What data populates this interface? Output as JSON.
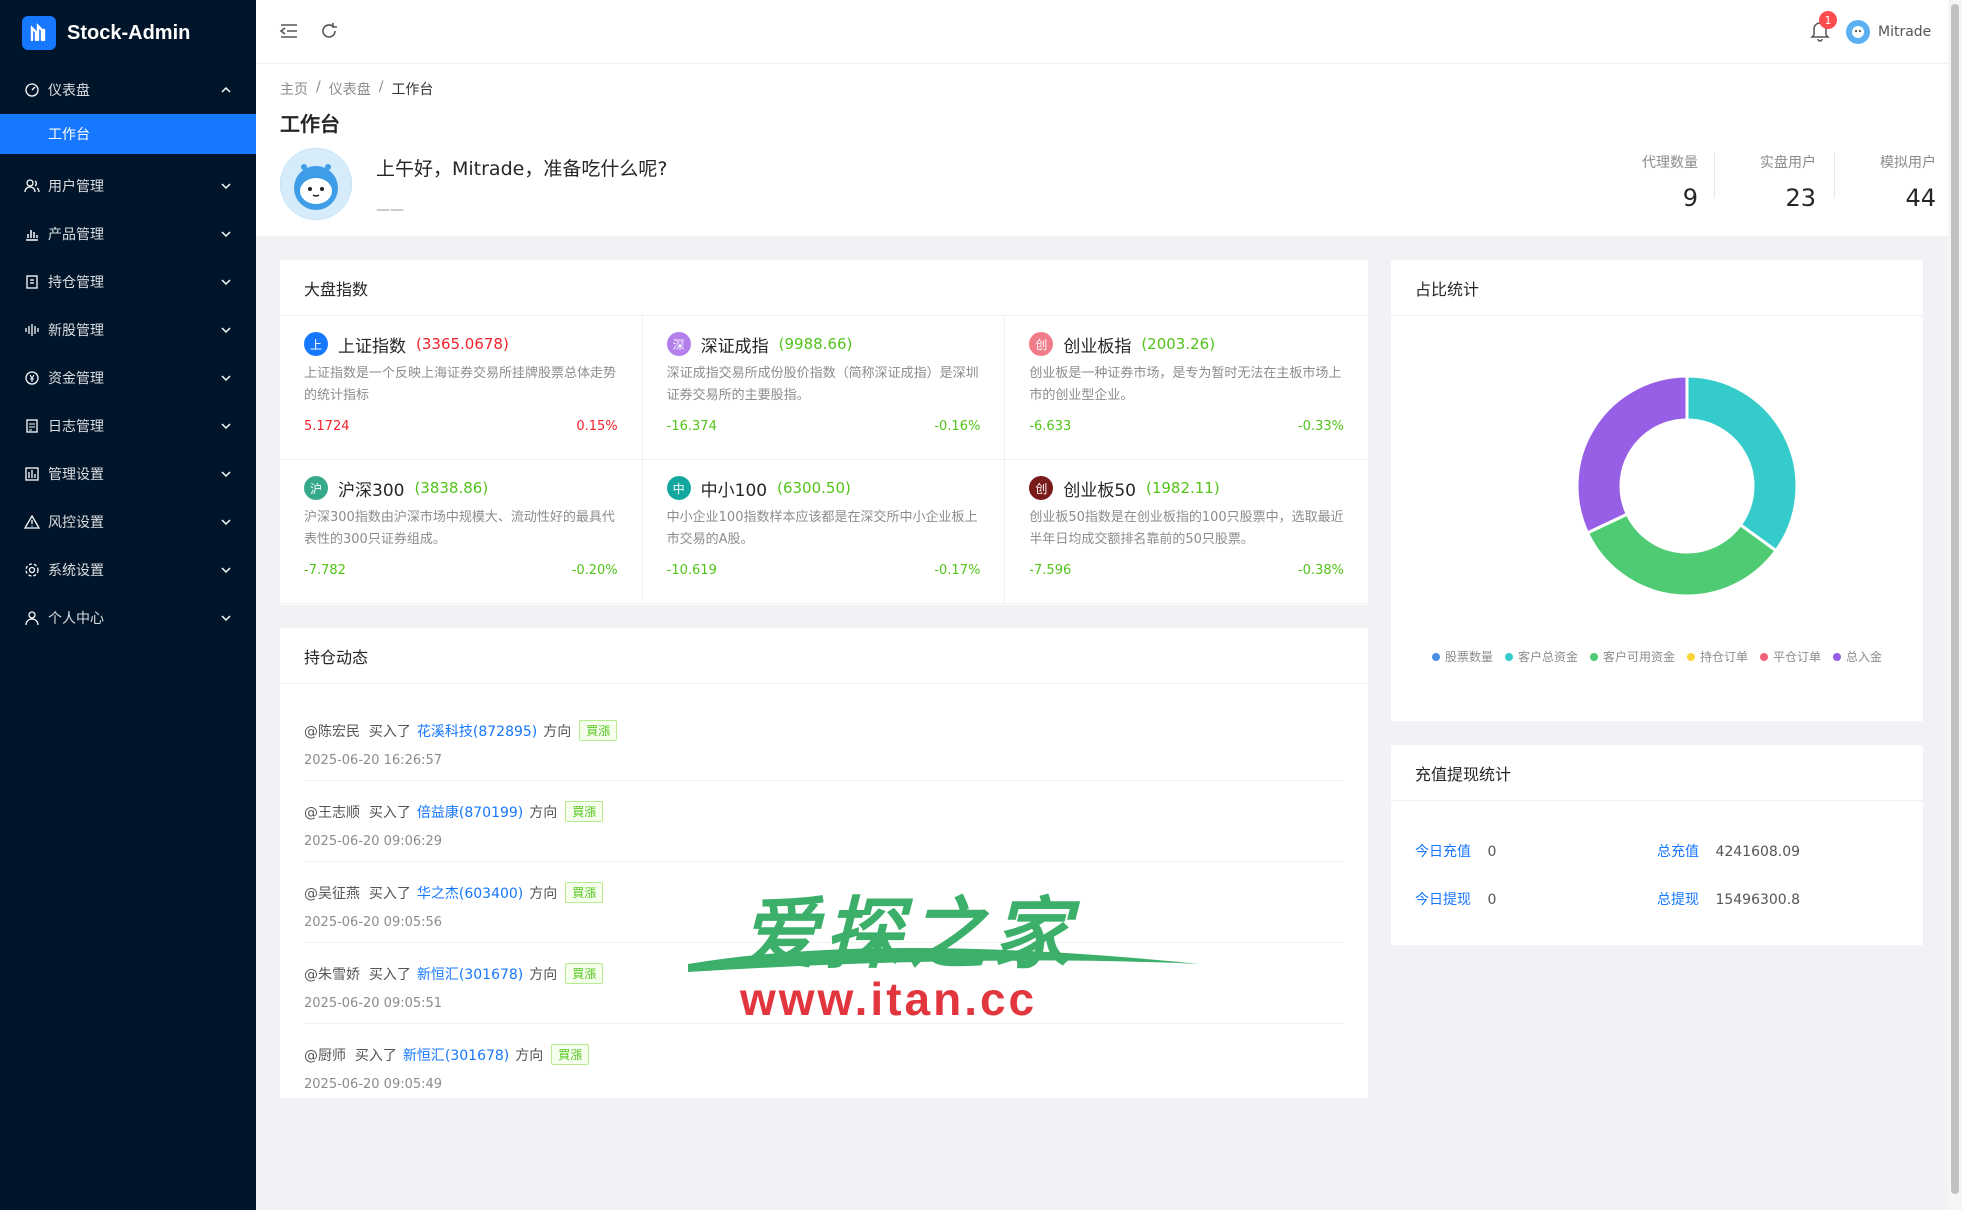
{
  "app": {
    "title": "Stock-Admin"
  },
  "sidebar": {
    "items": [
      {
        "label": "仪表盘",
        "icon": "dashboard-icon",
        "expanded": true
      },
      {
        "label": "用户管理",
        "icon": "users-icon"
      },
      {
        "label": "产品管理",
        "icon": "bar-chart-icon"
      },
      {
        "label": "持仓管理",
        "icon": "file-icon"
      },
      {
        "label": "新股管理",
        "icon": "audio-icon"
      },
      {
        "label": "资金管理",
        "icon": "money-icon"
      },
      {
        "label": "日志管理",
        "icon": "log-icon"
      },
      {
        "label": "管理设置",
        "icon": "grid-icon"
      },
      {
        "label": "风控设置",
        "icon": "warning-icon"
      },
      {
        "label": "系统设置",
        "icon": "gear-icon"
      },
      {
        "label": "个人中心",
        "icon": "user-icon"
      }
    ],
    "sub_active": "工作台"
  },
  "header": {
    "notifications": "1",
    "username": "Mitrade"
  },
  "breadcrumb": {
    "home": "主页",
    "sep": "/",
    "parent": "仪表盘",
    "current": "工作台"
  },
  "page": {
    "title": "工作台",
    "greeting": "上午好，Mitrade，准备吃什么呢?",
    "dash": "——"
  },
  "stats": [
    {
      "label": "代理数量",
      "value": "9"
    },
    {
      "label": "实盘用户",
      "value": "23"
    },
    {
      "label": "模拟用户",
      "value": "44"
    }
  ],
  "indices": {
    "title": "大盘指数",
    "items": [
      {
        "badge": "上",
        "color": "#1677ff",
        "name": "上证指数",
        "value": "(3365.0678)",
        "valueColor": "red",
        "desc": "上证指数是一个反映上海证券交易所挂牌股票总体走势的统计指标",
        "change": "5.1724",
        "pct": "0.15%",
        "dir": "red"
      },
      {
        "badge": "深",
        "color": "#b37feb",
        "name": "深证成指",
        "value": "(9988.66)",
        "valueColor": "green",
        "desc": "深证成指交易所成份股价指数（简称深证成指）是深圳证券交易所的主要股指。",
        "change": "-16.374",
        "pct": "-0.16%",
        "dir": "green"
      },
      {
        "badge": "创",
        "color": "#f07c8a",
        "name": "创业板指",
        "value": "(2003.26)",
        "valueColor": "green",
        "desc": "创业板是一种证券市场，是专为暂时无法在主板市场上市的创业型企业。",
        "change": "-6.633",
        "pct": "-0.33%",
        "dir": "green"
      },
      {
        "badge": "沪",
        "color": "#36a88e",
        "name": "沪深300",
        "value": "(3838.86)",
        "valueColor": "green",
        "desc": "沪深300指数由沪深市场中规模大、流动性好的最具代表性的300只证券组成。",
        "change": "-7.782",
        "pct": "-0.20%",
        "dir": "green"
      },
      {
        "badge": "中",
        "color": "#13a89e",
        "name": "中小100",
        "value": "(6300.50)",
        "valueColor": "green",
        "desc": "中小企业100指数样本应该都是在深交所中小企业板上市交易的A股。",
        "change": "-10.619",
        "pct": "-0.17%",
        "dir": "green"
      },
      {
        "badge": "创",
        "color": "#7a1b1b",
        "name": "创业板50",
        "value": "(1982.11)",
        "valueColor": "green",
        "desc": "创业板50指数是在创业板指的100只股票中，选取最近半年日均成交额排名靠前的50只股票。",
        "change": "-7.596",
        "pct": "-0.38%",
        "dir": "green"
      }
    ]
  },
  "positions": {
    "title": "持仓动态",
    "items": [
      {
        "user": "@陈宏民",
        "action": "买入了",
        "stock": "花溪科技(872895)",
        "dir_label": "方向",
        "tag": "買漲",
        "time": "2025-06-20 16:26:57"
      },
      {
        "user": "@王志顺",
        "action": "买入了",
        "stock": "倍益康(870199)",
        "dir_label": "方向",
        "tag": "買漲",
        "time": "2025-06-20 09:06:29"
      },
      {
        "user": "@吴征燕",
        "action": "买入了",
        "stock": "华之杰(603400)",
        "dir_label": "方向",
        "tag": "買漲",
        "time": "2025-06-20 09:05:56"
      },
      {
        "user": "@朱雪娇",
        "action": "买入了",
        "stock": "新恒汇(301678)",
        "dir_label": "方向",
        "tag": "買漲",
        "time": "2025-06-20 09:05:51"
      },
      {
        "user": "@厨师",
        "action": "买入了",
        "stock": "新恒汇(301678)",
        "dir_label": "方向",
        "tag": "買漲",
        "time": "2025-06-20 09:05:49"
      }
    ]
  },
  "chart_data": {
    "type": "pie",
    "title": "占比统计",
    "legend_position": "bottom",
    "categories": [
      "股票数量",
      "客户总资金",
      "客户可用资金",
      "持仓订单",
      "平仓订单",
      "总入金"
    ],
    "values": [
      0,
      35,
      33,
      0,
      0,
      32
    ],
    "colors": [
      "#4a90e2",
      "#36cbcb",
      "#4ecb73",
      "#fbd437",
      "#f2637b",
      "#975fe5"
    ]
  },
  "recharge": {
    "title": "充值提现统计",
    "today_recharge_label": "今日充值",
    "today_recharge": "0",
    "total_recharge_label": "总充值",
    "total_recharge": "4241608.09",
    "today_withdraw_label": "今日提现",
    "today_withdraw": "0",
    "total_withdraw_label": "总提现",
    "total_withdraw": "15496300.8"
  },
  "watermark": {
    "line1": "爱探之家",
    "line2": "www.itan.cc"
  }
}
